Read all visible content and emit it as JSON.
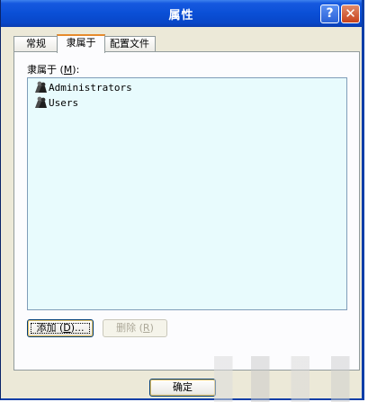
{
  "window": {
    "title": "属性",
    "help_glyph": "?",
    "close_glyph": "✕"
  },
  "tabs": [
    {
      "label": "常规",
      "selected": false
    },
    {
      "label": "隶属于",
      "selected": true
    },
    {
      "label": "配置文件",
      "selected": false
    }
  ],
  "member_of": {
    "label_prefix": "隶属于 (",
    "label_key": "M",
    "label_suffix": "):",
    "items": [
      {
        "name": "Administrators",
        "icon": "user-group-icon"
      },
      {
        "name": "Users",
        "icon": "user-group-icon"
      }
    ],
    "list_background": "#e8fbfd"
  },
  "buttons": {
    "add_prefix": "添加 (",
    "add_key": "D",
    "add_suffix": ")...",
    "remove_prefix": "删除 (",
    "remove_key": "R",
    "remove_suffix": ")",
    "ok": "确定"
  },
  "colors": {
    "titlebar": "#0a4fd6",
    "dialog_bg": "#ece9d8",
    "selected_tab_accent": "#e68b2c"
  }
}
